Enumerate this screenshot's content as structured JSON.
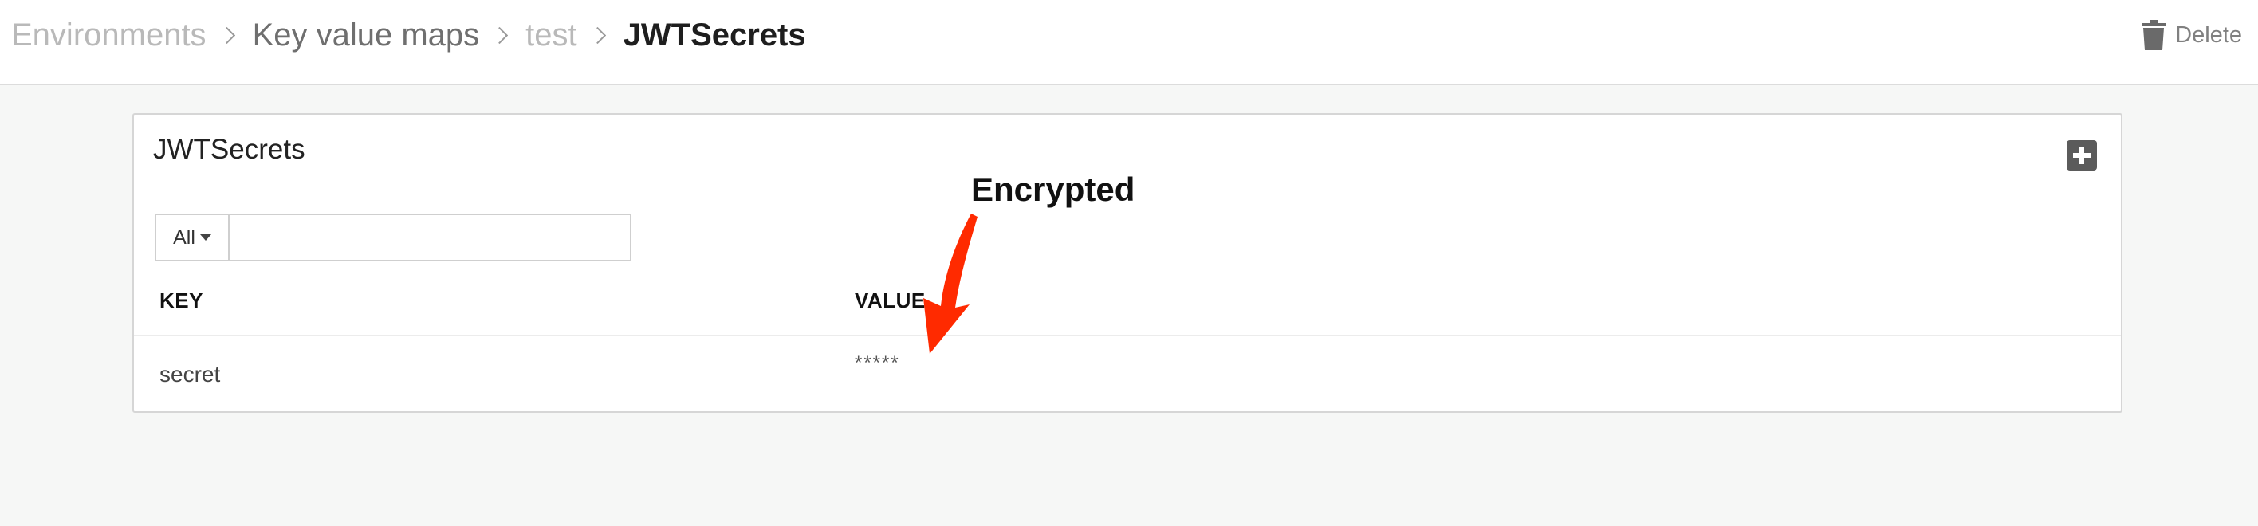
{
  "breadcrumb": {
    "items": [
      {
        "label": "Environments"
      },
      {
        "label": "Key value maps"
      },
      {
        "label": "test"
      },
      {
        "label": "JWTSecrets"
      }
    ]
  },
  "header": {
    "delete_label": "Delete"
  },
  "panel": {
    "title": "JWTSecrets",
    "filter": {
      "selected": "All",
      "value": "",
      "placeholder": ""
    },
    "table": {
      "columns": [
        "KEY",
        "VALUE"
      ],
      "rows": [
        {
          "key": "secret",
          "value": "*****"
        }
      ]
    }
  },
  "annotation": {
    "text": "Encrypted",
    "color": "#ff2a00"
  },
  "icons": [
    "trash-icon",
    "plus-icon",
    "chevron-right-icon",
    "caret-down-icon",
    "arrow-annotation-icon"
  ]
}
